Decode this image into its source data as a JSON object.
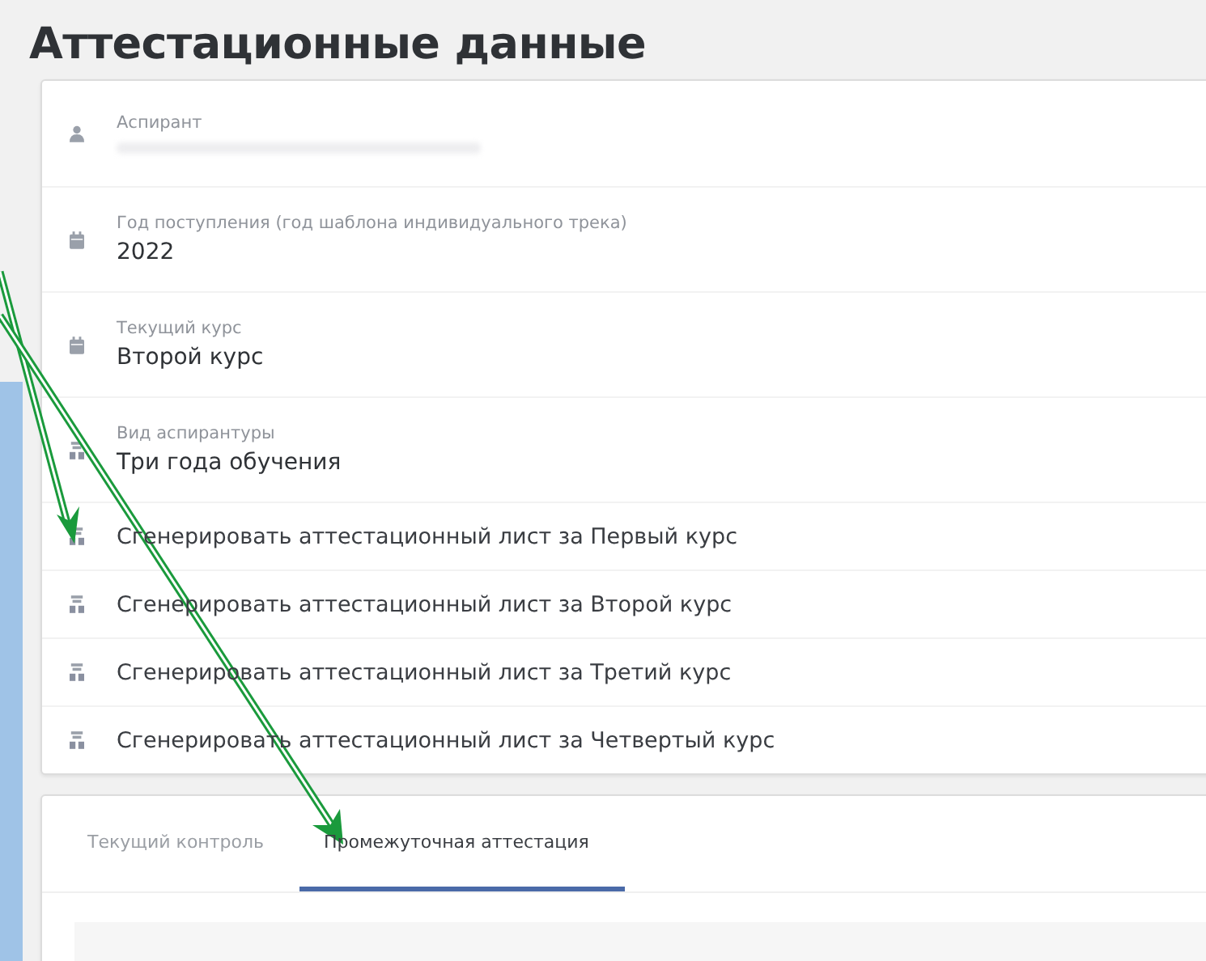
{
  "title": "Аттестационные данные",
  "fields": [
    {
      "kind": "person",
      "label": "Аспирант",
      "value_blurred": true
    },
    {
      "kind": "date",
      "label": "Год поступления (год шаблона индивидуального трека)",
      "value": "2022"
    },
    {
      "kind": "date",
      "label": "Текущий курс",
      "value": "Второй курс"
    },
    {
      "kind": "type",
      "label": "Вид аспирантуры",
      "value": "Три года обучения"
    }
  ],
  "actions": [
    "Сгенерировать аттестационный лист за Первый курс",
    "Сгенерировать аттестационный лист за Второй курс",
    "Сгенерировать аттестационный лист за Третий курс",
    "Сгенерировать аттестационный лист за Четвертый курс"
  ],
  "tabs": [
    {
      "label": "Текущий контроль",
      "selected": false
    },
    {
      "label": "Промежуточная аттестация",
      "selected": true
    }
  ]
}
